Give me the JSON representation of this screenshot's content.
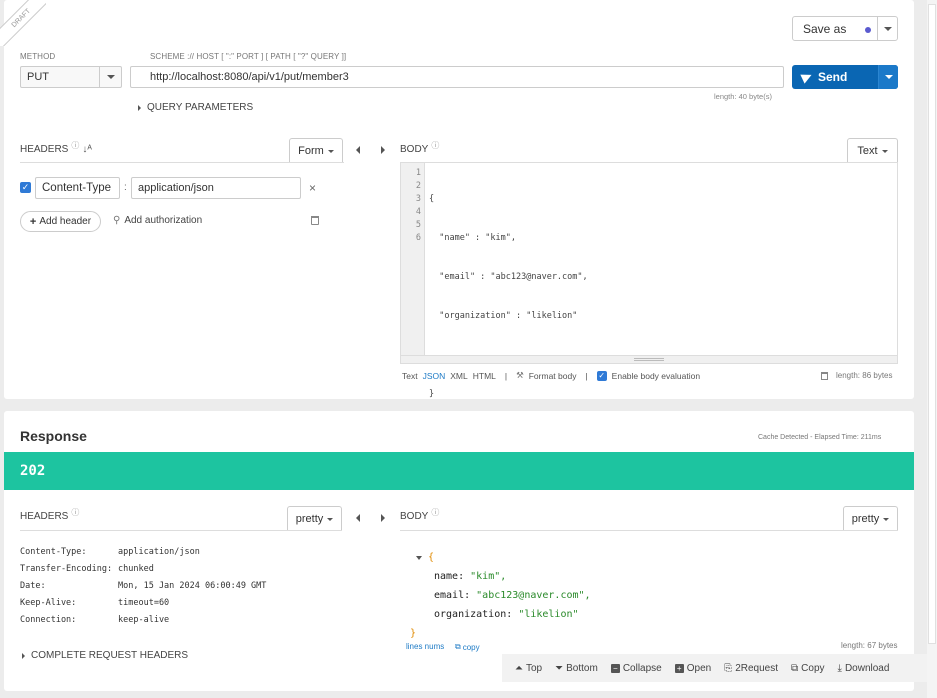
{
  "draft_label": "DRAFT",
  "request": {
    "method_label": "METHOD",
    "method_value": "PUT",
    "url_label": "SCHEME :// HOST [ \":\" PORT ] [ PATH [ \"?\" QUERY ]]",
    "url_value": "http://localhost:8080/api/v1/put/member3",
    "url_length": "length: 40 byte(s)",
    "save_as": "Save as",
    "send": "Send",
    "query_parameters": "QUERY PARAMETERS",
    "headers_label": "HEADERS",
    "headers_mode": "Form",
    "header_name": "Content-Type",
    "header_value": "application/json",
    "add_header": "Add header",
    "add_authorization": "Add authorization",
    "body_label": "BODY",
    "body_mode": "Text",
    "body_lines": [
      "{",
      "  \"name\" : \"kim\",",
      "  \"email\" : \"abc123@naver.com\",",
      "  \"organization\" : \"likelion\"",
      "",
      "}"
    ],
    "line_numbers": [
      "1",
      "2",
      "3",
      "4",
      "5",
      "6"
    ],
    "formats": {
      "text": "Text",
      "json": "JSON",
      "xml": "XML",
      "html": "HTML"
    },
    "format_body": "Format body",
    "enable_eval": "Enable body evaluation",
    "body_length": "length: 86 bytes"
  },
  "response": {
    "title": "Response",
    "cache_info": "Cache Detected - Elapsed Time: 211ms",
    "status": "202",
    "status_color": "#1dc4a0",
    "headers_label": "HEADERS",
    "headers_mode": "pretty",
    "headers": [
      {
        "name": "Content-Type:",
        "value": "application/json"
      },
      {
        "name": "Transfer-Encoding:",
        "value": "chunked"
      },
      {
        "name": "Date:",
        "value": "Mon, 15 Jan 2024 06:00:49 GMT"
      },
      {
        "name": "Keep-Alive:",
        "value": "timeout=60"
      },
      {
        "name": "Connection:",
        "value": "keep-alive"
      }
    ],
    "complete_headers": "COMPLETE REQUEST HEADERS",
    "body_label": "BODY",
    "body_mode": "pretty",
    "json_open": "{",
    "json_close": "}",
    "fields": [
      {
        "key": "name:",
        "value": "\"kim\","
      },
      {
        "key": "email:",
        "value": "\"abc123@naver.com\","
      },
      {
        "key": "organization:",
        "value": "\"likelion\""
      }
    ],
    "lines_nums": "lines nums",
    "copy_small": "copy",
    "body_length": "length: 67 bytes"
  },
  "toolbar": {
    "top": "Top",
    "bottom": "Bottom",
    "collapse": "Collapse",
    "open": "Open",
    "to_request": "2Request",
    "copy": "Copy",
    "download": "Download"
  },
  "colors": {
    "send": "#0a66b3",
    "link": "#1e7bc6",
    "json_string": "#2a8a2a",
    "json_brace": "#e08a00"
  }
}
